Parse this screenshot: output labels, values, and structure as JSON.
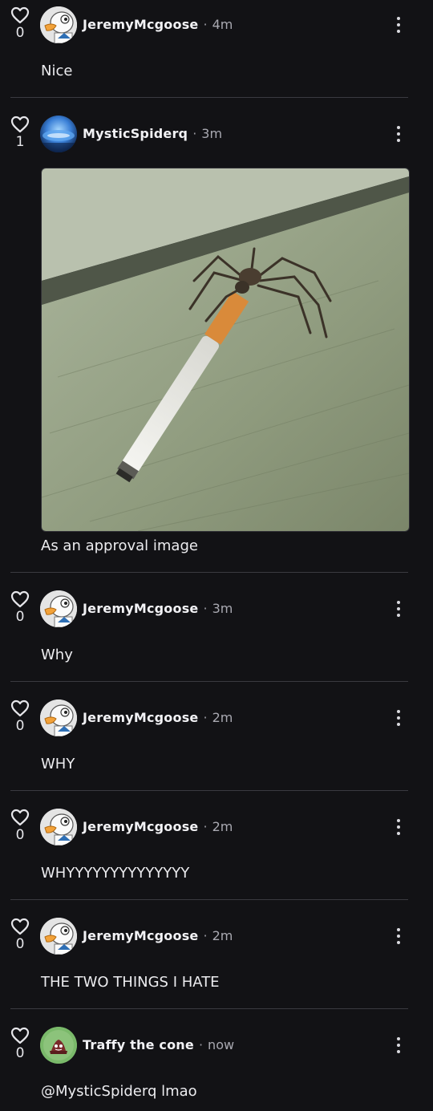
{
  "comments": [
    {
      "author": "JeremyMcgoose",
      "sep": "·",
      "time": "4m",
      "likes": "0",
      "text": "Nice",
      "avatar": "goose-avatar"
    },
    {
      "author": "MysticSpiderq",
      "sep": "·",
      "time": "3m",
      "likes": "1",
      "text": "As an approval image",
      "avatar": "blue-orb-avatar",
      "image": "spider-holding-cigarette-photo"
    },
    {
      "author": "JeremyMcgoose",
      "sep": "·",
      "time": "3m",
      "likes": "0",
      "text": "Why",
      "avatar": "goose-avatar"
    },
    {
      "author": "JeremyMcgoose",
      "sep": "·",
      "time": "2m",
      "likes": "0",
      "text": "WHY",
      "avatar": "goose-avatar"
    },
    {
      "author": "JeremyMcgoose",
      "sep": "·",
      "time": "2m",
      "likes": "0",
      "text": "WHYYYYYYYYYYYYYY",
      "avatar": "goose-avatar"
    },
    {
      "author": "JeremyMcgoose",
      "sep": "·",
      "time": "2m",
      "likes": "0",
      "text": "THE TWO THINGS I HATE",
      "avatar": "goose-avatar"
    },
    {
      "author": "Traffy the cone",
      "sep": "·",
      "time": "now",
      "likes": "0",
      "text": "@MysticSpiderq lmao",
      "avatar": "traffy-cone-avatar"
    }
  ],
  "colors": {
    "background": "#121215",
    "divider": "#3a3a40",
    "text": "#ececef",
    "muted": "#a9a9b1"
  }
}
